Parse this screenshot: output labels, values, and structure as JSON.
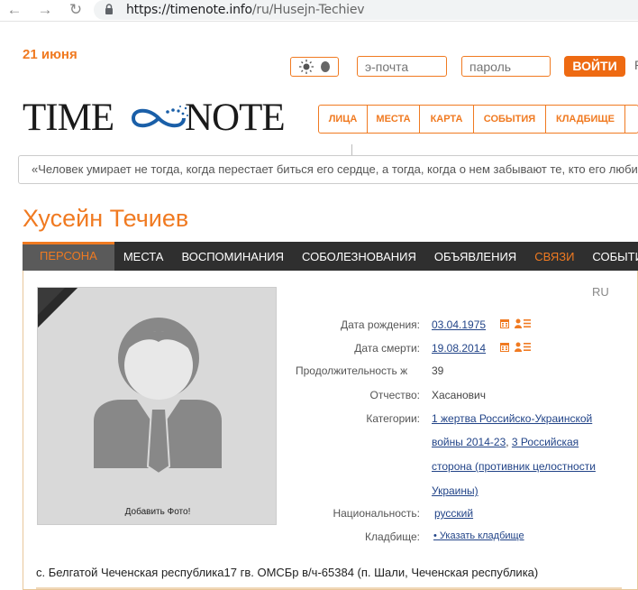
{
  "browser": {
    "url_domain": "https://timenote.info",
    "url_path": "/ru/Husejn-Techiev"
  },
  "header": {
    "date": "21 июня",
    "email_placeholder": "э-почта",
    "password_placeholder": "пароль",
    "login_label": "ВОЙТИ",
    "extra_link": "Р",
    "logo_left": "TIME",
    "logo_right": "NOTE"
  },
  "topnav": {
    "items": [
      {
        "label": "ЛИЦА"
      },
      {
        "label": "МЕСТА"
      },
      {
        "label": "КАРТА"
      },
      {
        "label": "СОБЫТИЯ"
      },
      {
        "label": "КЛАДБИЩЕ"
      },
      {
        "label": ""
      }
    ]
  },
  "quote": "«Человек умирает не тогда, когда перестает биться его сердце, а тогда, когда о нем забывают те, кто его люби",
  "person": {
    "name": "Хусейн Течиев",
    "photo_caption": "Добавить Фото!",
    "lang": "RU",
    "birth_label": "Дата рождения:",
    "birth_value": "03.04.1975",
    "death_label": "Дата смерти:",
    "death_value": "19.08.2014",
    "duration_label": "Продолжительность ж",
    "duration_value": "39",
    "patronymic_label": "Отчество:",
    "patronymic_value": "Хасанович",
    "categories_label": "Категории:",
    "categories_lines": [
      "1 жертва Российско-Украинской",
      "войны 2014-23",
      "3 Российская",
      "сторона (противник целостности",
      "Украины)"
    ],
    "categories_sep": ", ",
    "nationality_label": "Национальность:",
    "nationality_value": "русский",
    "cemetery_label": "Кладбище:",
    "cemetery_value": "• Указать кладбище",
    "address": "с. Белгатой Чеченская республика17 гв. ОМСБр в/ч-65384 (п. Шали, Чеченская республика)"
  },
  "tabs": [
    {
      "label": "ПЕРСОНА"
    },
    {
      "label": "МЕСТА"
    },
    {
      "label": "ВОСПОМИНАНИЯ"
    },
    {
      "label": "СОБОЛЕЗНОВАНИЯ"
    },
    {
      "label": "ОБЪЯВЛЕНИЯ"
    },
    {
      "label": "СВЯЗИ"
    },
    {
      "label": "СОБЫТИЯ"
    }
  ],
  "colors": {
    "accent": "#f07a21",
    "link": "#224488",
    "tabbar": "#2f2f2f"
  }
}
